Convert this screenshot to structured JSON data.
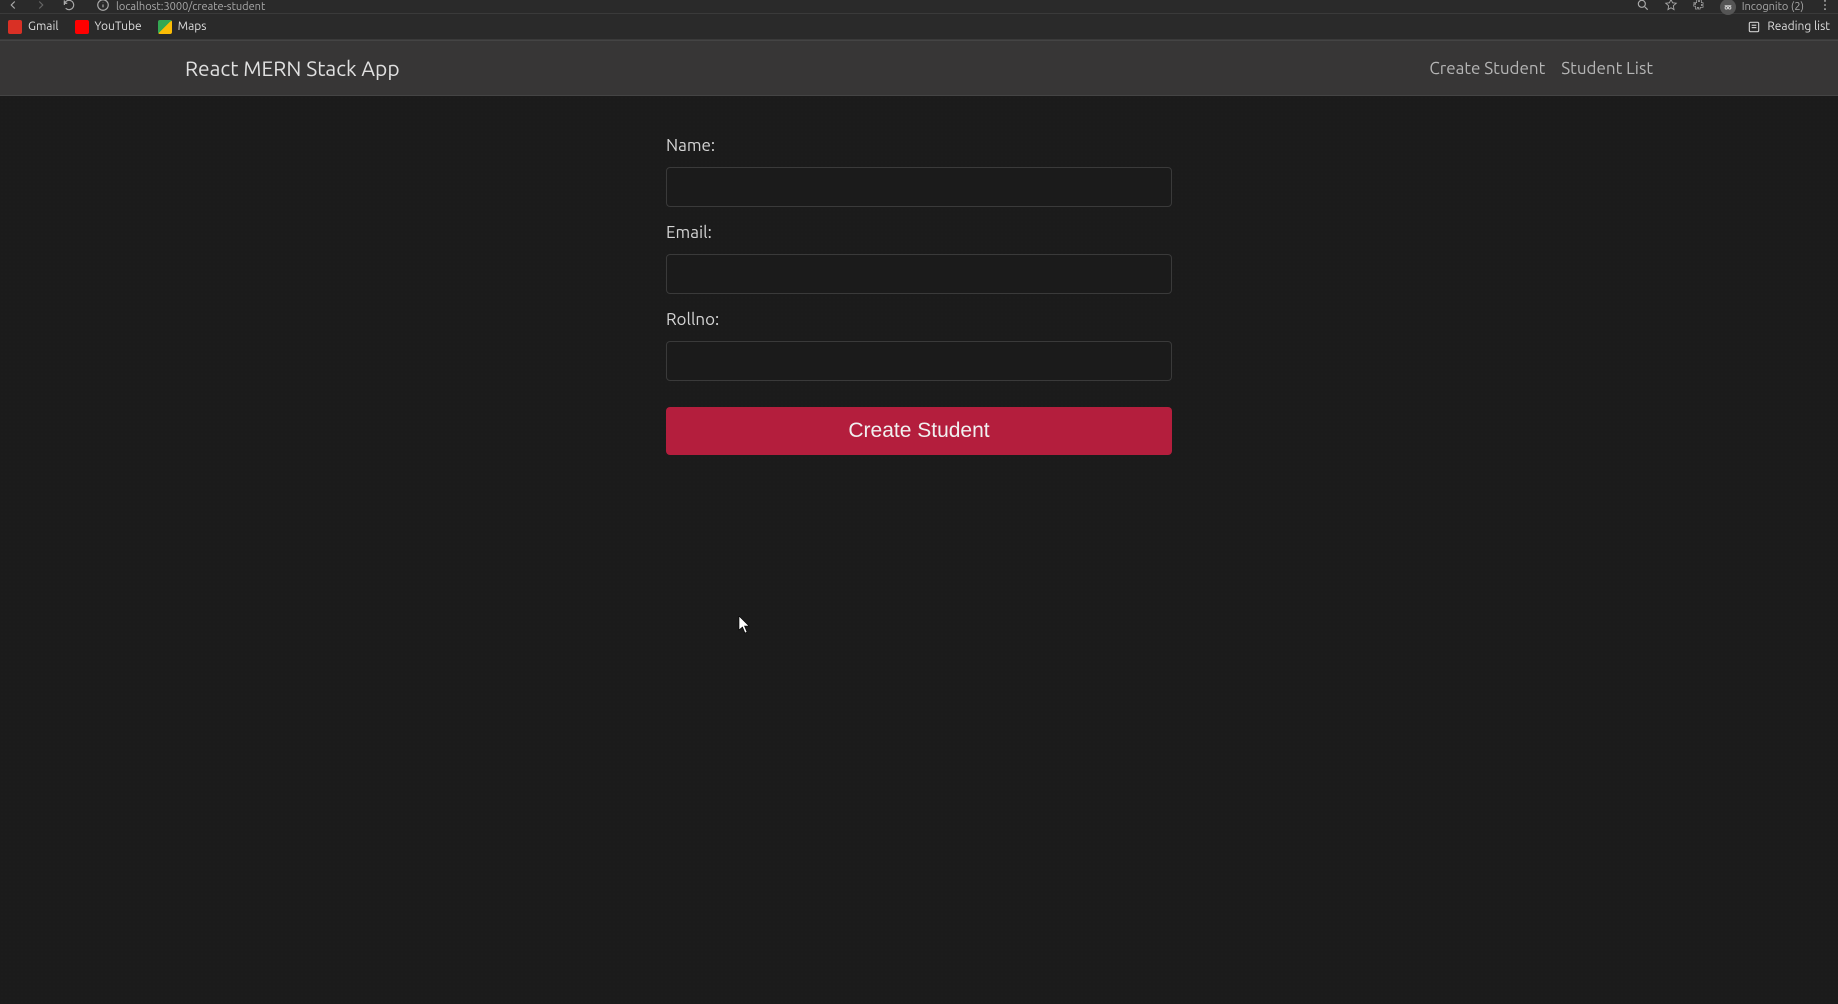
{
  "browser": {
    "url": "localhost:3000/create-student",
    "incognito": "Incognito (2)"
  },
  "bookmarks": {
    "gmail": "Gmail",
    "youtube": "YouTube",
    "maps": "Maps",
    "reading_list": "Reading list"
  },
  "navbar": {
    "brand": "React MERN Stack App",
    "link_create": "Create Student",
    "link_list": "Student List"
  },
  "form": {
    "name_label": "Name:",
    "name_value": "",
    "email_label": "Email:",
    "email_value": "",
    "rollno_label": "Rollno:",
    "rollno_value": "",
    "submit_label": "Create Student"
  }
}
